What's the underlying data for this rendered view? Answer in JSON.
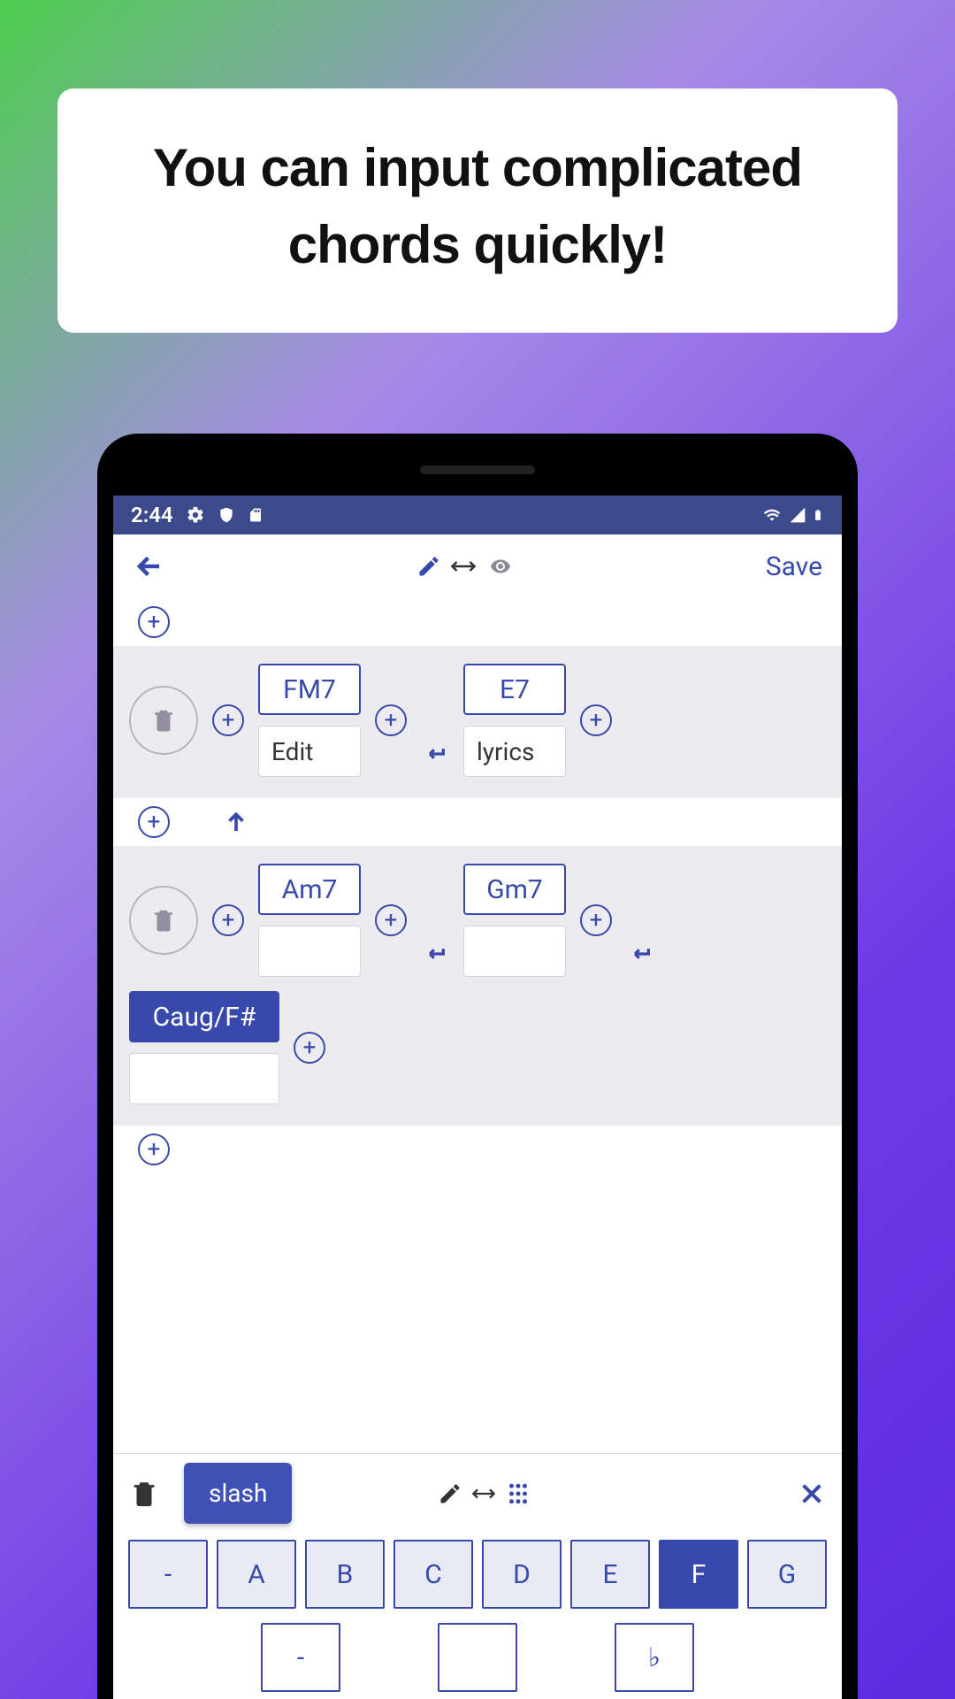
{
  "promo": {
    "headline": "You can input complicated chords quickly!"
  },
  "status": {
    "time": "2:44"
  },
  "toolbar": {
    "save": "Save"
  },
  "rows": [
    {
      "cells": [
        {
          "chord": "FM7",
          "lyric": "Edit"
        },
        {
          "chord": "E7",
          "lyric": "lyrics"
        }
      ]
    },
    {
      "cells": [
        {
          "chord": "Am7",
          "lyric": ""
        },
        {
          "chord": "Gm7",
          "lyric": ""
        }
      ],
      "extra": {
        "chord": "Caug/F#"
      }
    }
  ],
  "keyboard": {
    "chip": "slash",
    "row1": [
      "-",
      "A",
      "B",
      "C",
      "D",
      "E",
      "F",
      "G"
    ],
    "row1_active": "F",
    "row2": [
      "-",
      "#",
      "♭"
    ],
    "row2_active": "#"
  }
}
